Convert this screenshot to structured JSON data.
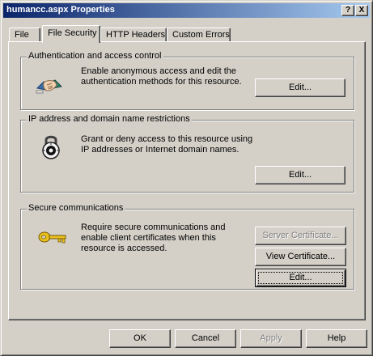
{
  "window": {
    "title": "humancc.aspx Properties",
    "help_label": "?",
    "close_label": "X"
  },
  "tabs": [
    {
      "label": "File"
    },
    {
      "label": "File Security",
      "active": true
    },
    {
      "label": "HTTP Headers"
    },
    {
      "label": "Custom Errors"
    }
  ],
  "auth": {
    "title": "Authentication and access control",
    "description": "Enable anonymous access and edit the\nauthentication methods for this resource.",
    "edit_label": "Edit...",
    "icon": "handshake-icon"
  },
  "ip": {
    "title": "IP address and domain name restrictions",
    "description": "Grant or deny access to this resource using\nIP addresses or Internet domain names.",
    "edit_label": "Edit...",
    "icon": "padlock-icon"
  },
  "secure": {
    "title": "Secure communications",
    "description": "Require secure communications and\nenable client certificates when this\nresource is accessed.",
    "server_cert_label": "Server Certificate...",
    "view_cert_label": "View Certificate...",
    "edit_label": "Edit...",
    "icon": "key-icon"
  },
  "footer": {
    "ok_label": "OK",
    "cancel_label": "Cancel",
    "apply_label": "Apply",
    "help_label": "Help"
  }
}
